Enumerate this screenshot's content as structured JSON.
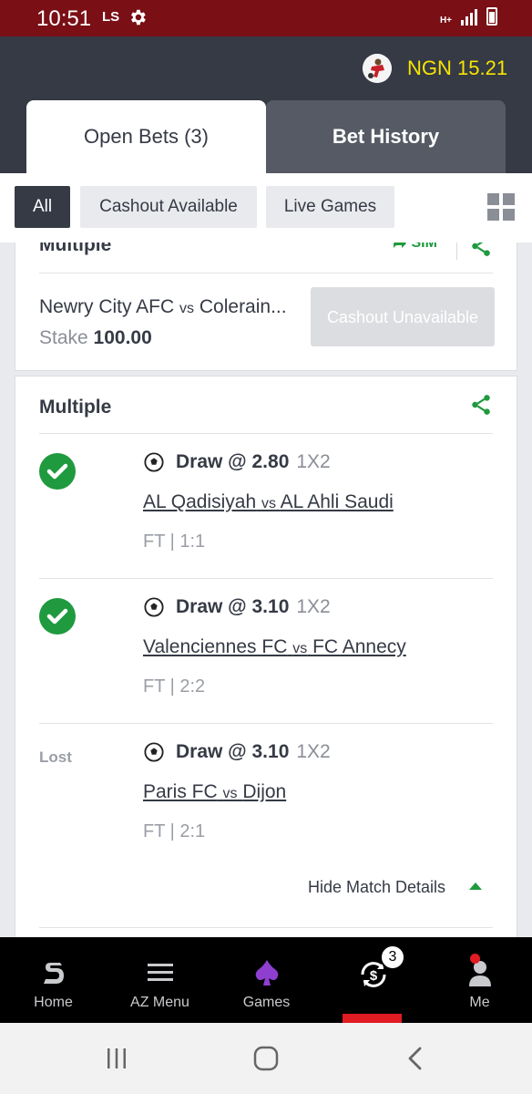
{
  "status_bar": {
    "time": "10:51",
    "carrier": "LS",
    "network": "H+"
  },
  "header": {
    "balance": "NGN 15.21"
  },
  "tabs": [
    {
      "label": "Open Bets (3)",
      "active": true
    },
    {
      "label": "Bet History",
      "active": false
    }
  ],
  "filters": [
    {
      "label": "All",
      "active": true
    },
    {
      "label": "Cashout Available",
      "active": false
    },
    {
      "label": "Live Games",
      "active": false
    }
  ],
  "bet_card_1": {
    "title": "Multiple",
    "sim_label": "SIM",
    "match_home": "Newry City AFC",
    "vs": "vs",
    "match_away": "Colerain...",
    "stake_label": "Stake",
    "stake_value": "100.00",
    "cashout_label": "Cashout Unavailable"
  },
  "bet_card_2": {
    "title": "Multiple",
    "legs": [
      {
        "status": "won",
        "pick": "Draw @ 2.80",
        "market": "1X2",
        "home": "AL Qadisiyah",
        "vs": "vs",
        "away": "AL Ahli Saudi",
        "result": "FT | 1:1"
      },
      {
        "status": "won",
        "pick": "Draw @ 3.10",
        "market": "1X2",
        "home": "Valenciennes FC",
        "vs": "vs",
        "away": "FC Annecy",
        "result": "FT | 2:2"
      },
      {
        "status": "lost",
        "status_label": "Lost",
        "pick": "Draw @ 3.10",
        "market": "1X2",
        "home": "Paris FC",
        "vs": "vs",
        "away": "Dijon",
        "result": "FT | 2:1"
      }
    ],
    "hide_details_label": "Hide Match Details"
  },
  "bottom_nav": [
    {
      "label": "Home",
      "icon": "sportybet-logo-icon"
    },
    {
      "label": "AZ Menu",
      "icon": "hamburger-icon"
    },
    {
      "label": "Games",
      "icon": "spade-icon"
    },
    {
      "label": "",
      "icon": "cashout-icon",
      "badge": "3",
      "active": true
    },
    {
      "label": "Me",
      "icon": "person-icon"
    }
  ],
  "colors": {
    "accent_green": "#1f9a3e",
    "header_dark": "#353a45",
    "status_red": "#7a0f16",
    "balance_yellow": "#f7e400",
    "active_red": "#e01b22"
  }
}
